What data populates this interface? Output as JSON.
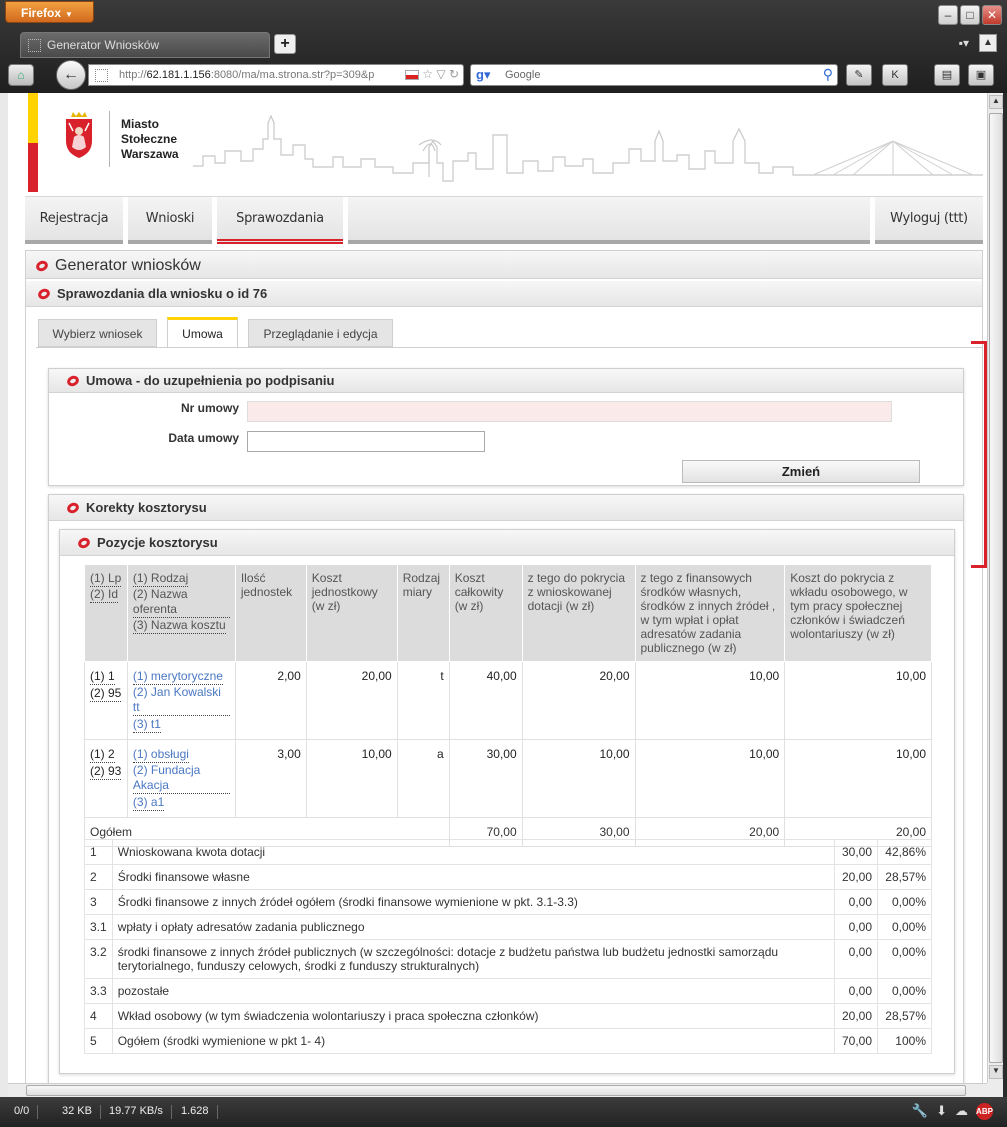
{
  "browser": {
    "app_button": "Firefox",
    "tab_title": "Generator Wniosków",
    "url_prefix": "http://",
    "url_host": "62.181.1.156",
    "url_rest": ":8080/ma/ma.strona.str?p=309&p",
    "search_placeholder": "Google"
  },
  "header": {
    "city_line1": "Miasto",
    "city_line2": "Stołeczne",
    "city_line3": "Warszawa"
  },
  "menu": {
    "rejestracja": "Rejestracja",
    "wnioski": "Wnioski",
    "sprawozdania": "Sprawozdania",
    "wyloguj": "Wyloguj (ttt)"
  },
  "page": {
    "title": "Generator wniosków",
    "subtitle": "Sprawozdania dla wniosku o id 76"
  },
  "tabs": {
    "wybierz": "Wybierz wniosek",
    "umowa": "Umowa",
    "przegladanie": "Przeglądanie i edycja"
  },
  "umowa": {
    "title": "Umowa - do uzupełnienia po podpisaniu",
    "nr_label": "Nr umowy",
    "nr_value": "",
    "data_label": "Data umowy",
    "data_value": "",
    "button": "Zmień"
  },
  "korekty": {
    "title": "Korekty kosztorysu",
    "pozycje_title": "Pozycje kosztorysu"
  },
  "cost_table": {
    "headers": {
      "lp1": "(1) Lp",
      "lp2": "(2) Id",
      "rodzaj1": "(1) Rodzaj",
      "rodzaj2": "(2) Nazwa oferenta",
      "rodzaj3": "(3) Nazwa kosztu",
      "ilosc": "Ilość jednostek",
      "koszt_jedn": "Koszt jednostkowy (w zł)",
      "miary": "Rodzaj miary",
      "koszt_calk": "Koszt całkowity (w zł)",
      "dotacja": "z tego do pokrycia z wnioskowanej dotacji (w zł)",
      "wlasne": "z tego z finansowych środków własnych, środków z innych źródeł , w tym wpłat i opłat adresatów zadania publicznego (w zł)",
      "osobowy": "Koszt do pokrycia z wkładu osobowego, w tym pracy społecznej członków i świadczeń wolontariuszy (w zł)"
    },
    "rows": [
      {
        "lp": "(1) 1",
        "id": "(2) 95",
        "rodzaj": "(1) merytoryczne",
        "oferent": "(2) Jan Kowalski tt",
        "koszt": "(3) t1",
        "ilosc": "2,00",
        "jedn": "20,00",
        "miara": "t",
        "calk": "40,00",
        "dotacja": "20,00",
        "wlasne": "10,00",
        "osobowy": "10,00"
      },
      {
        "lp": "(1) 2",
        "id": "(2) 93",
        "rodzaj": "(1) obsługi",
        "oferent": "(2) Fundacja Akacja",
        "koszt": "(3) a1",
        "ilosc": "3,00",
        "jedn": "10,00",
        "miara": "a",
        "calk": "30,00",
        "dotacja": "10,00",
        "wlasne": "10,00",
        "osobowy": "10,00"
      }
    ],
    "total": {
      "label": "Ogółem",
      "calk": "70,00",
      "dotacja": "30,00",
      "wlasne": "20,00",
      "osobowy": "20,00"
    }
  },
  "summary": [
    {
      "n": "1",
      "label": "Wnioskowana kwota dotacji",
      "value": "30,00",
      "pct": "42,86%"
    },
    {
      "n": "2",
      "label": "Środki finansowe własne",
      "value": "20,00",
      "pct": "28,57%"
    },
    {
      "n": "3",
      "label": "Środki finansowe z innych źródeł ogółem (środki finansowe wymienione w pkt. 3.1-3.3)",
      "value": "0,00",
      "pct": "0,00%"
    },
    {
      "n": "3.1",
      "label": "wpłaty i opłaty adresatów zadania publicznego",
      "value": "0,00",
      "pct": "0,00%"
    },
    {
      "n": "3.2",
      "label": "środki finansowe z innych źródeł publicznych (w szczególności: dotacje z budżetu państwa lub budżetu jednostki samorządu terytorialnego, funduszy celowych, środki z funduszy strukturalnych)",
      "value": "0,00",
      "pct": "0,00%"
    },
    {
      "n": "3.3",
      "label": "pozostałe",
      "value": "0,00",
      "pct": "0,00%"
    },
    {
      "n": "4",
      "label": "Wkład osobowy (w tym świadczenia wolontariuszy i praca społeczna członków)",
      "value": "20,00",
      "pct": "28,57%"
    },
    {
      "n": "5",
      "label": "Ogółem (środki wymienione w pkt 1- 4)",
      "value": "70,00",
      "pct": "100%"
    }
  ],
  "status": {
    "count": "0/0",
    "size": "32 KB",
    "speed": "19.77 KB/s",
    "time": "1.628"
  },
  "colors": {
    "accent_red": "#d8212b",
    "accent_yellow": "#ffd200",
    "link_blue": "#4a78c2"
  }
}
